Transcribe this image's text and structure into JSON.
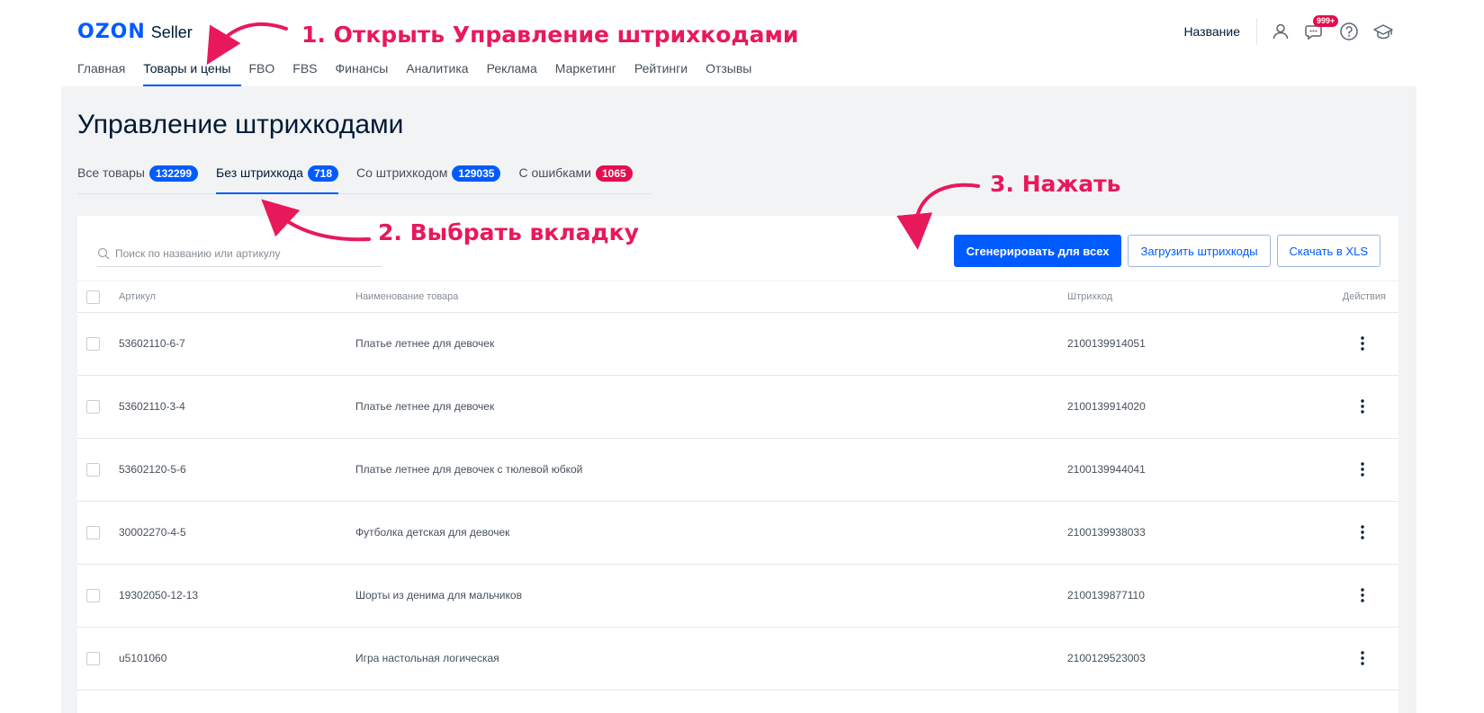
{
  "header": {
    "logo_brand": "OZON",
    "logo_suffix": "Seller",
    "shop_name": "Название",
    "notification_badge": "999+",
    "nav": [
      {
        "label": "Главная",
        "active": false
      },
      {
        "label": "Товары и цены",
        "active": true
      },
      {
        "label": "FBO",
        "active": false
      },
      {
        "label": "FBS",
        "active": false
      },
      {
        "label": "Финансы",
        "active": false
      },
      {
        "label": "Аналитика",
        "active": false
      },
      {
        "label": "Реклама",
        "active": false
      },
      {
        "label": "Маркетинг",
        "active": false
      },
      {
        "label": "Рейтинги",
        "active": false
      },
      {
        "label": "Отзывы",
        "active": false
      }
    ],
    "icons": [
      "user-icon",
      "chat-icon",
      "help-icon",
      "education-icon"
    ]
  },
  "page": {
    "title": "Управление штрихкодами",
    "tabs": [
      {
        "label": "Все товары",
        "count": "132299",
        "active": false,
        "error": false
      },
      {
        "label": "Без штрихкода",
        "count": "718",
        "active": true,
        "error": false
      },
      {
        "label": "Со штрихкодом",
        "count": "129035",
        "active": false,
        "error": false
      },
      {
        "label": "С ошибками",
        "count": "1065",
        "active": false,
        "error": true
      }
    ]
  },
  "toolbar": {
    "search_placeholder": "Поиск по названию или артикулу",
    "generate_label": "Сгенерировать для всех",
    "upload_label": "Загрузить штрихкоды",
    "download_label": "Скачать в XLS"
  },
  "table": {
    "headers": {
      "article": "Артикул",
      "name": "Наименование товара",
      "barcode": "Штрихкод",
      "actions": "Действия"
    },
    "rows": [
      {
        "article": "53602110-6-7",
        "name": "Платье летнее для девочек",
        "barcode": "2100139914051"
      },
      {
        "article": "53602110-3-4",
        "name": "Платье летнее для девочек",
        "barcode": "2100139914020"
      },
      {
        "article": "53602120-5-6",
        "name": "Платье летнее для девочек с тюлевой юбкой",
        "barcode": "2100139944041"
      },
      {
        "article": "30002270-4-5",
        "name": "Футболка детская для девочек",
        "barcode": "2100139938033"
      },
      {
        "article": "19302050-12-13",
        "name": "Шорты из денима для мальчиков",
        "barcode": "2100139877110"
      },
      {
        "article": "u5101060",
        "name": "Игра настольная логическая",
        "barcode": "2100129523003"
      }
    ]
  },
  "annotations": {
    "step1": "1. Открыть Управление штрихкодами",
    "step2": "2. Выбрать вкладку",
    "step3": "3. Нажать"
  },
  "colors": {
    "accent": "#005bff",
    "error": "#e30d4f",
    "annotation": "#e8195a",
    "background": "#f2f3f5"
  }
}
